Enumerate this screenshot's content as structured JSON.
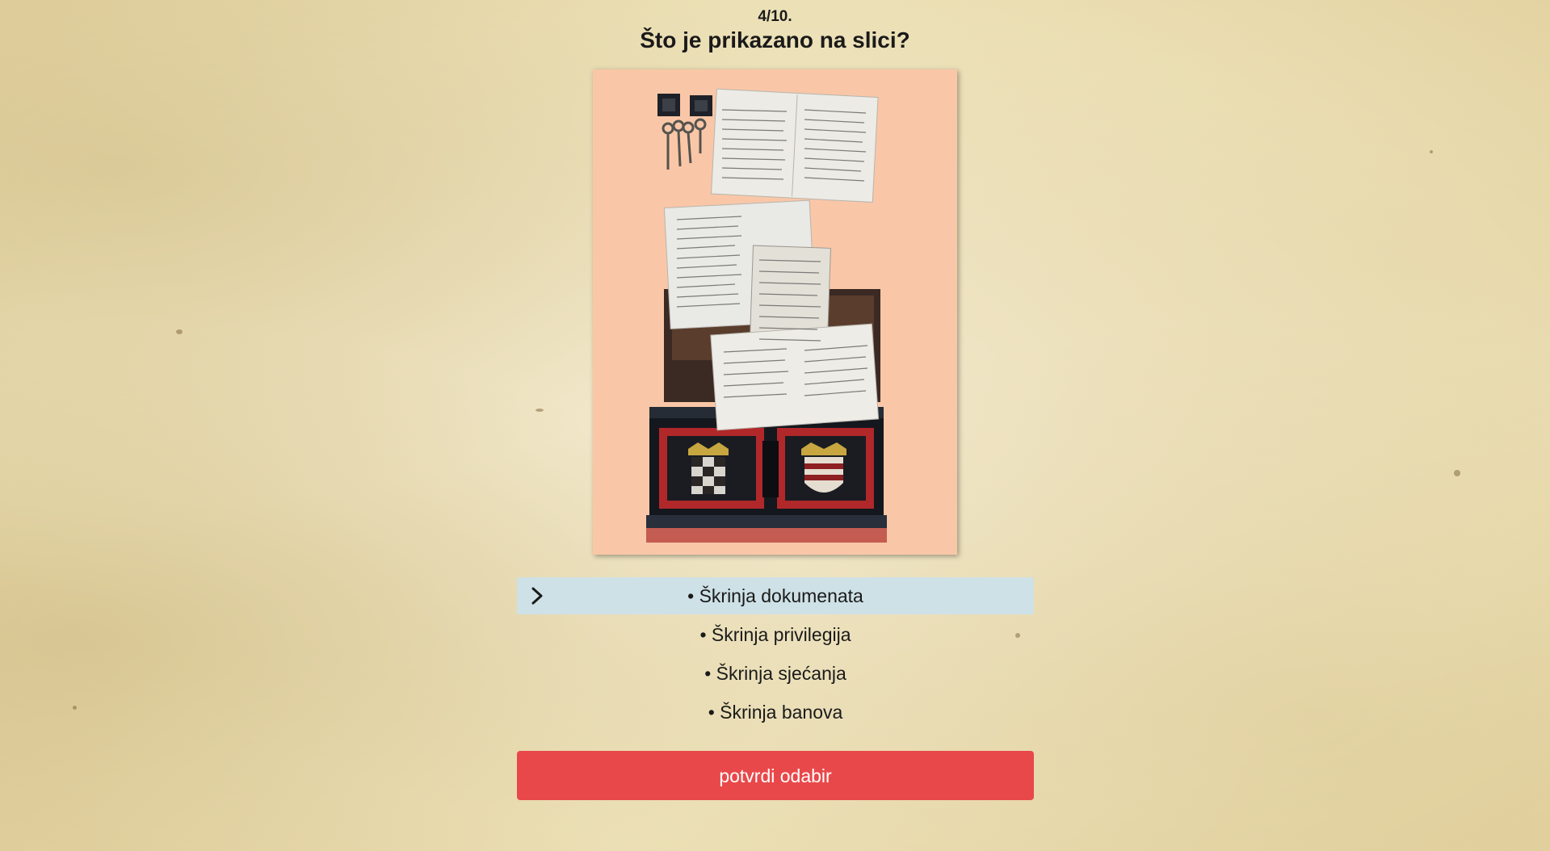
{
  "quiz": {
    "counter": "4/10.",
    "question": "Što je prikazano na slici?"
  },
  "image": {
    "subject_icon": "document-chest-photo",
    "background_color": "#f9c7a7"
  },
  "answers": [
    {
      "label": "• Škrinja dokumenata",
      "selected": true
    },
    {
      "label": "• Škrinja privilegija",
      "selected": false
    },
    {
      "label": "• Škrinja sjećanja",
      "selected": false
    },
    {
      "label": "• Škrinja banova",
      "selected": false
    }
  ],
  "confirm_button": {
    "label": "potvrdi odabir",
    "color": "#e9484a"
  },
  "colors": {
    "selected_answer_bg": "#cee1e6",
    "page_bg": "#ede1b8"
  }
}
